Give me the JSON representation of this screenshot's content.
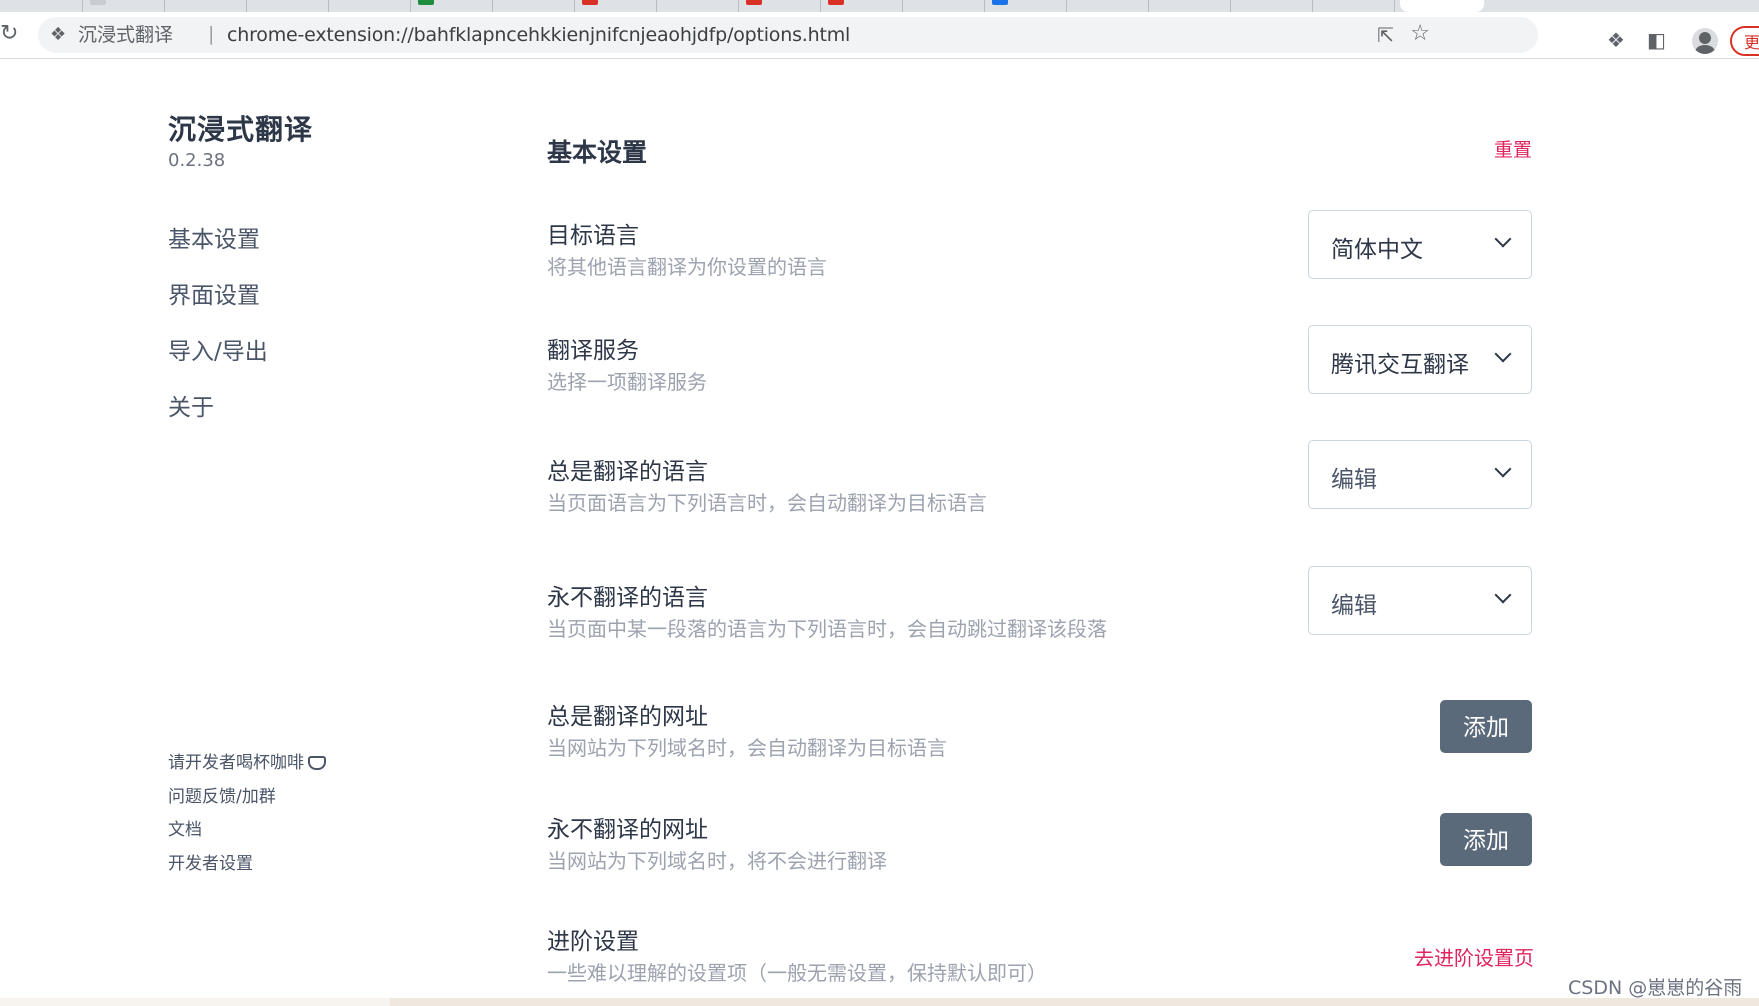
{
  "browser": {
    "extension_name": "沉浸式翻译",
    "url": "chrome-extension://bahfklapncehkkienjnifcnjeaohjdfp/options.html",
    "update_label": "更"
  },
  "sidebar": {
    "brand": "沉浸式翻译",
    "version": "0.2.38",
    "nav": [
      "基本设置",
      "界面设置",
      "导入/导出",
      "关于"
    ],
    "footer_links": [
      "请开发者喝杯咖啡",
      "问题反馈/加群",
      "文档",
      "开发者设置"
    ]
  },
  "main": {
    "title": "基本设置",
    "reset_label": "重置",
    "rows": [
      {
        "title": "目标语言",
        "desc": "将其他语言翻译为你设置的语言",
        "control": "简体中文"
      },
      {
        "title": "翻译服务",
        "desc": "选择一项翻译服务",
        "control": "腾讯交互翻译"
      },
      {
        "title": "总是翻译的语言",
        "desc": "当页面语言为下列语言时，会自动翻译为目标语言",
        "control": "编辑"
      },
      {
        "title": "永不翻译的语言",
        "desc": "当页面中某一段落的语言为下列语言时，会自动跳过翻译该段落",
        "control": "编辑"
      },
      {
        "title": "总是翻译的网址",
        "desc": "当网站为下列域名时，会自动翻译为目标语言",
        "control": "添加"
      },
      {
        "title": "永不翻译的网址",
        "desc": "当网站为下列域名时，将不会进行翻译",
        "control": "添加"
      },
      {
        "title": "进阶设置",
        "desc": "一些难以理解的设置项（一般无需设置，保持默认即可）",
        "control": "去进阶设置页"
      }
    ]
  },
  "watermark": "CSDN @崽崽的谷雨",
  "colors": {
    "accent": "#e0245e",
    "button": "#5a6a7b",
    "text": "#2d3748",
    "muted": "#9ca3af"
  }
}
